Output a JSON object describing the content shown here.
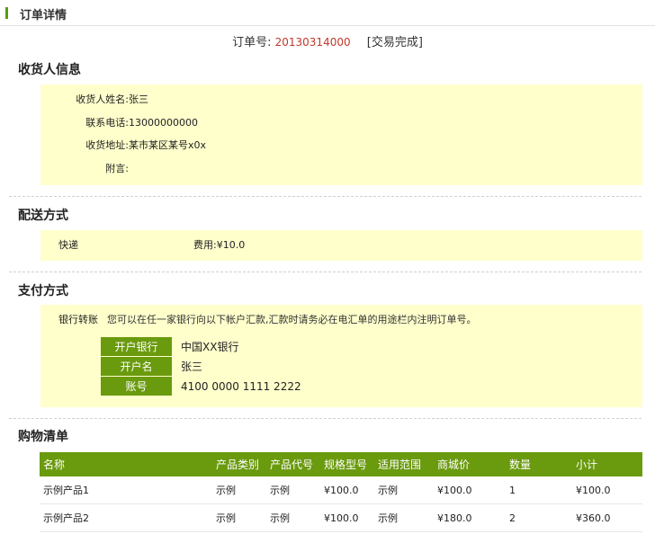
{
  "header": {
    "title": "订单详情"
  },
  "order": {
    "label": "订单号:",
    "number": "20130314000",
    "status": "[交易完成]"
  },
  "receiver": {
    "title": "收货人信息",
    "fields": [
      {
        "label": "收货人姓名:",
        "value": "张三"
      },
      {
        "label": "联系电话:",
        "value": "13000000000"
      },
      {
        "label": "收货地址:",
        "value": "某市某区某号x0x"
      },
      {
        "label": "附言:",
        "value": ""
      }
    ]
  },
  "delivery": {
    "title": "配送方式",
    "method": "快递",
    "fee_label": "费用:",
    "fee_value": "¥10.0"
  },
  "payment": {
    "title": "支付方式",
    "method": "银行转账",
    "note": "您可以在任一家银行向以下帐户汇款,汇款时请务必在电汇单的用途栏内注明订单号。",
    "bank": [
      {
        "label": "开户银行",
        "value": "中国XX银行"
      },
      {
        "label": "开户名",
        "value": "张三"
      },
      {
        "label": "账号",
        "value": "4100 0000 1111 2222"
      }
    ]
  },
  "cart": {
    "title": "购物清单",
    "columns": [
      "名称",
      "产品类别",
      "产品代号",
      "规格型号",
      "适用范围",
      "商城价",
      "数量",
      "小计"
    ],
    "rows": [
      [
        "示例产品1",
        "示例",
        "示例",
        "¥100.0",
        "示例",
        "¥100.0",
        "1",
        "¥100.0"
      ],
      [
        "示例产品2",
        "示例",
        "示例",
        "¥100.0",
        "示例",
        "¥180.0",
        "2",
        "¥360.0"
      ]
    ]
  }
}
